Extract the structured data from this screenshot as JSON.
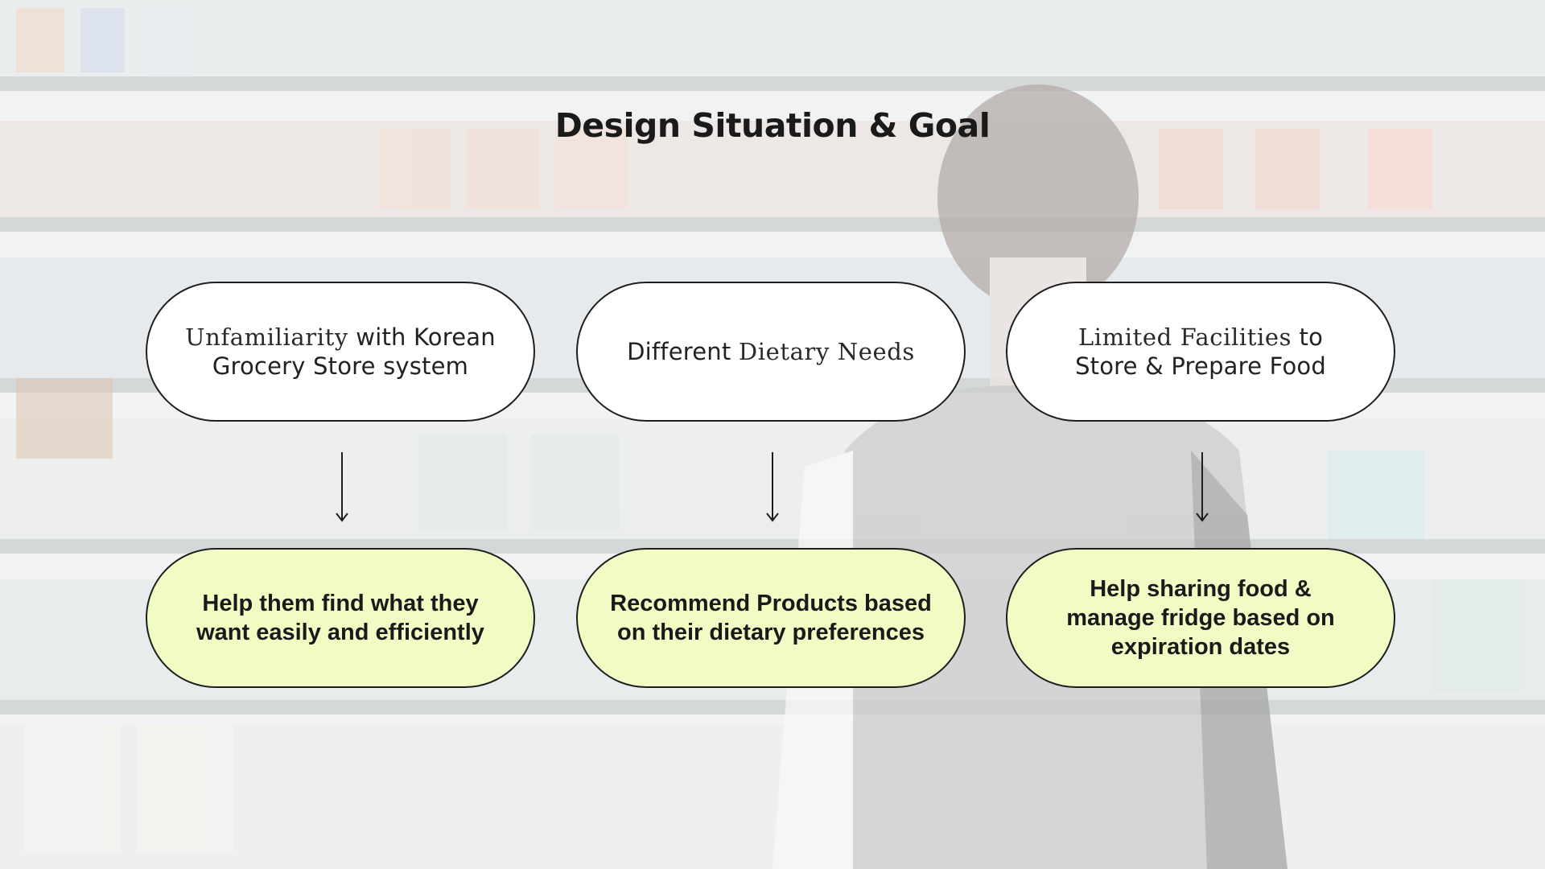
{
  "title": "Design Situation & Goal",
  "situations": [
    {
      "light": "Unfamiliarity",
      "rest_line1": " with Korean",
      "line2": "Grocery Store system"
    },
    {
      "lead": "Different ",
      "light": "Dietary Needs"
    },
    {
      "light": "Limited Facilities",
      "rest_line1": " to",
      "line2": "Store & Prepare Food"
    }
  ],
  "goals": [
    {
      "line1": "Help them find what they",
      "line2": "want easily and efficiently"
    },
    {
      "line1": "Recommend Products based",
      "line2": "on their dietary preferences"
    },
    {
      "line1": "Help sharing food &",
      "line2": "manage fridge based on",
      "line3": "expiration dates"
    }
  ],
  "colors": {
    "situation_fill": "#ffffff",
    "goal_fill": "#f0fcc3",
    "outline": "#1e1e1e"
  },
  "icons": [
    "down-arrow-icon",
    "down-arrow-icon",
    "down-arrow-icon"
  ]
}
